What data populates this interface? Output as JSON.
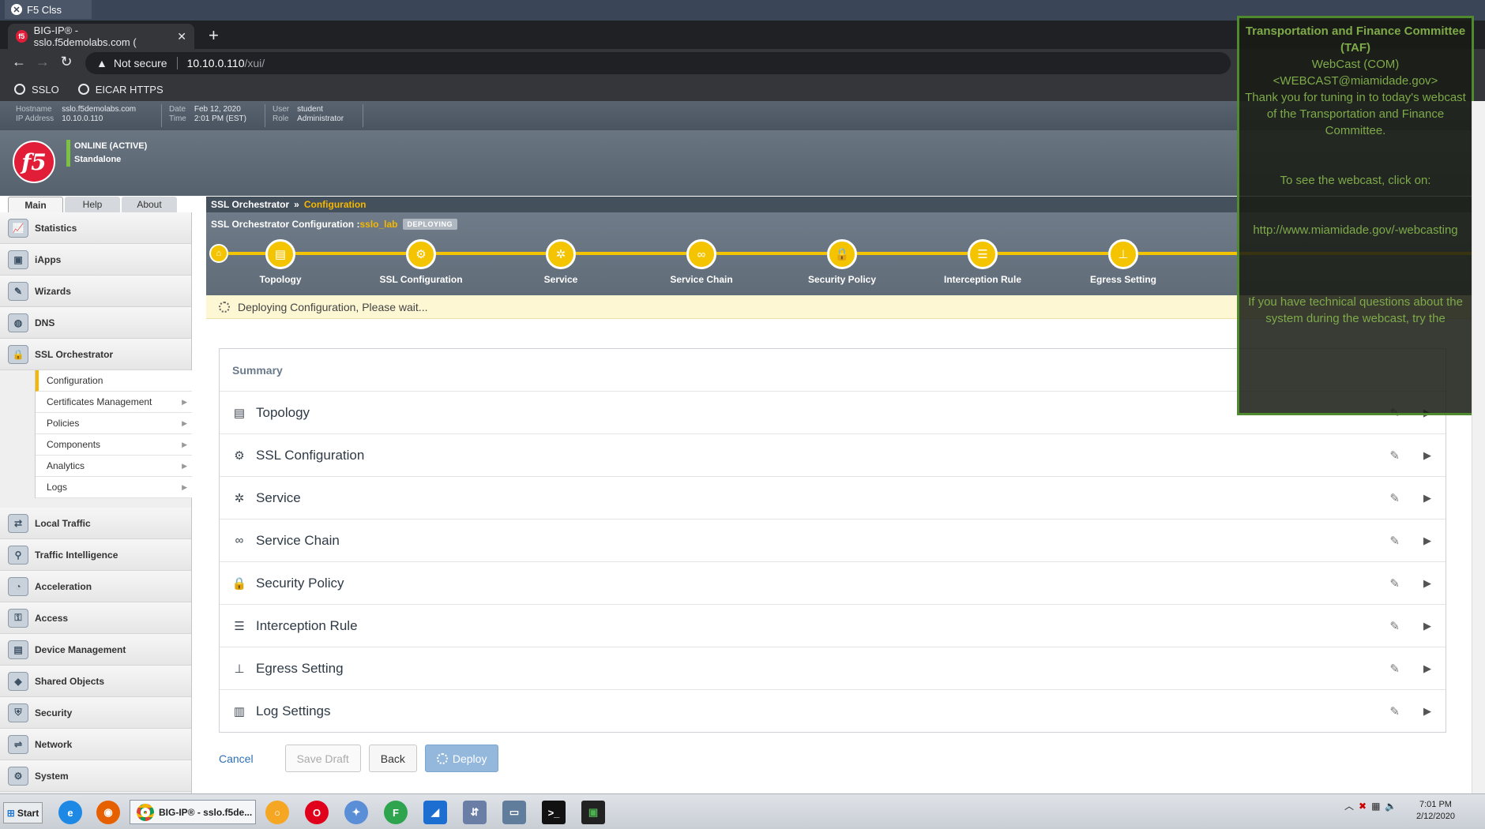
{
  "rdp": {
    "tab_title": "F5 Clss"
  },
  "browser": {
    "tab_title": "BIG-IP® - sslo.f5demolabs.com (",
    "security": "Not secure",
    "host": "10.10.0.110",
    "path": "/xui/",
    "bookmarks": [
      "SSLO",
      "EICAR HTTPS"
    ]
  },
  "bigip": {
    "hostname_label": "Hostname",
    "hostname": "sslo.f5demolabs.com",
    "ip_label": "IP Address",
    "ip": "10.10.0.110",
    "date_label": "Date",
    "date": "Feb 12, 2020",
    "time_label": "Time",
    "time": "2:01 PM (EST)",
    "user_label": "User",
    "user": "student",
    "role_label": "Role",
    "role": "Administrator",
    "status_line1": "ONLINE (ACTIVE)",
    "status_line2": "Standalone"
  },
  "main_tabs": [
    "Main",
    "Help",
    "About"
  ],
  "sidebar": {
    "items_top": [
      "Statistics",
      "iApps",
      "Wizards",
      "DNS",
      "SSL Orchestrator"
    ],
    "sub_items": [
      "Configuration",
      "Certificates Management",
      "Policies",
      "Components",
      "Analytics",
      "Logs"
    ],
    "items_bottom": [
      "Local Traffic",
      "Traffic Intelligence",
      "Acceleration",
      "Access",
      "Device Management",
      "Shared Objects",
      "Security",
      "Network",
      "System"
    ]
  },
  "breadcrumb": {
    "root": "SSL Orchestrator",
    "sep": "»",
    "current": "Configuration"
  },
  "config": {
    "title": "SSL Orchestrator Configuration :",
    "name": "sslo_lab",
    "badge": "DEPLOYING"
  },
  "steps": [
    "Topology",
    "SSL Configuration",
    "Service",
    "Service Chain",
    "Security Policy",
    "Interception Rule",
    "Egress Setting"
  ],
  "deploy_message": "Deploying Configuration, Please wait...",
  "summary": {
    "title": "Summary",
    "rows": [
      "Topology",
      "SSL Configuration",
      "Service",
      "Service Chain",
      "Security Policy",
      "Interception Rule",
      "Egress Setting",
      "Log Settings"
    ]
  },
  "actions": {
    "cancel": "Cancel",
    "save_draft": "Save Draft",
    "back": "Back",
    "deploy": "Deploy"
  },
  "overlay": {
    "title": "Transportation and Finance Committee (TAF)",
    "from": "WebCast (COM) <WEBCAST@miamidade.gov>",
    "body1": "Thank you for tuning in to today's webcast of the Transportation and Finance Committee.",
    "body2": "To see the webcast, click on:",
    "link": "http://www.miamidade.gov/-webcasting",
    "body3": "If you have technical questions about the system during the webcast, try the"
  },
  "taskbar": {
    "start": "Start",
    "task_label": "BIG-IP® - sslo.f5de...",
    "clock_time": "7:01 PM",
    "clock_date": "2/12/2020"
  }
}
